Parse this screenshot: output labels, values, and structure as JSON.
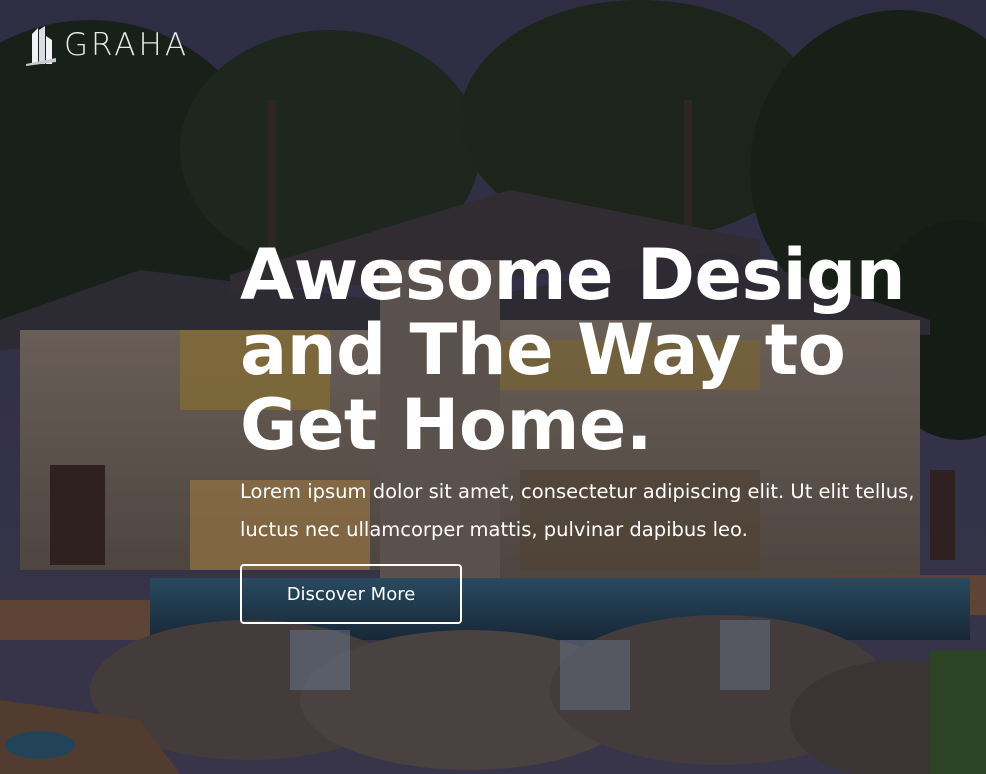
{
  "brand": {
    "name": "GRAHA",
    "logo_icon": "building-logo-icon"
  },
  "hero": {
    "headline": [
      "Awesome Design",
      "and The Way to",
      "Get Home."
    ],
    "subtext": "Lorem ipsum dolor sit amet, consectetur adipiscing elit. Ut elit tellus, luctus nec ullamcorper mattis, pulvinar dapibus leo.",
    "cta_label": "Discover More"
  },
  "colors": {
    "text": "#ffffff",
    "sky": "#3b3a55",
    "foliage": "#1f2a1c",
    "house": "#8a7a6d",
    "pool": "#2e5a78"
  }
}
